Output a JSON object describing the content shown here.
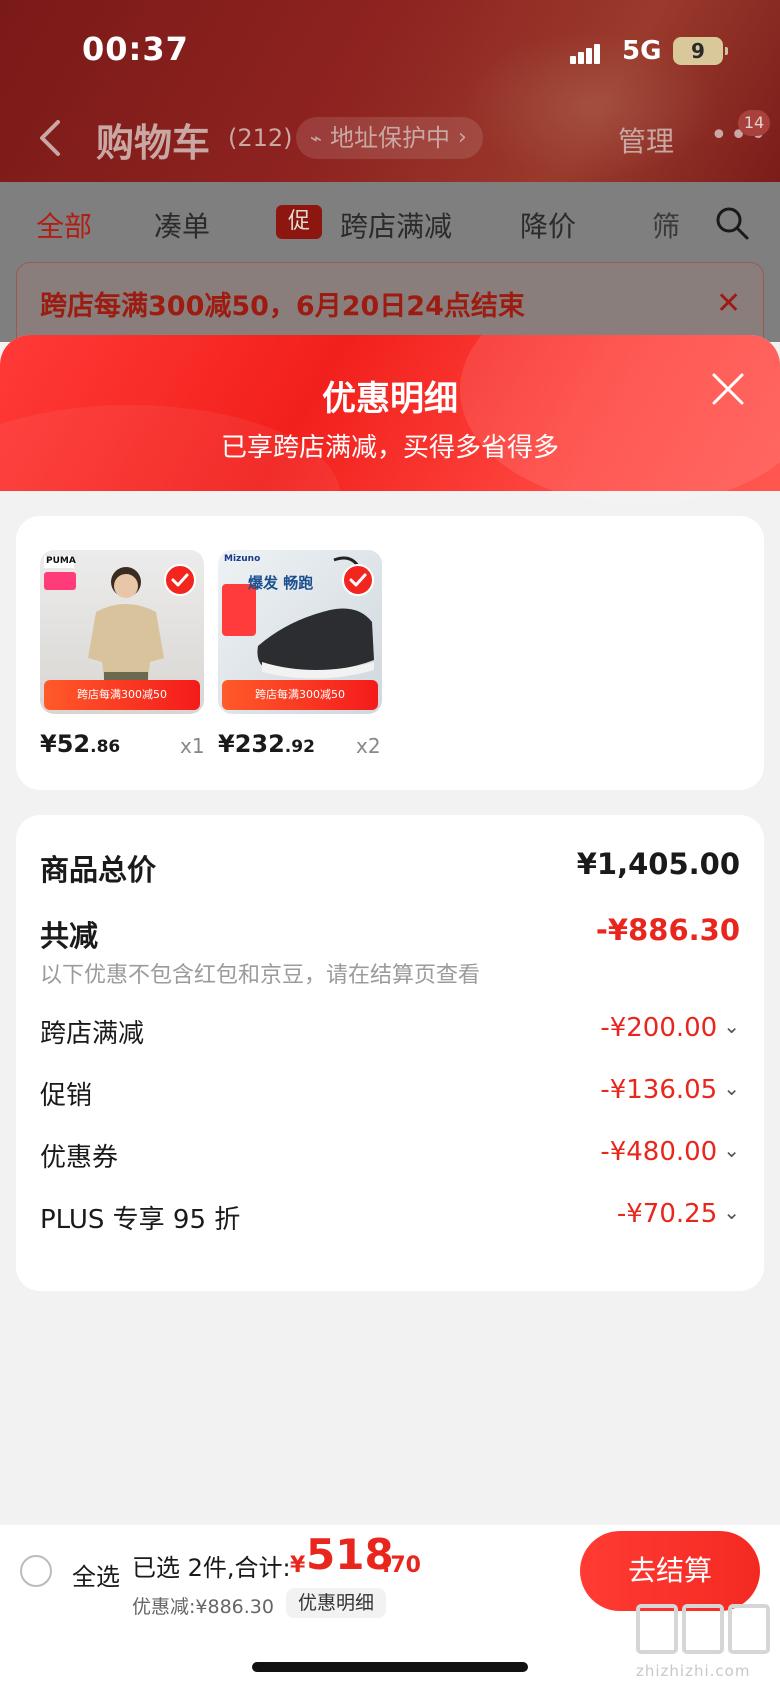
{
  "status_bar": {
    "time": "00:37",
    "network": "5G",
    "battery": "9"
  },
  "nav": {
    "title": "购物车",
    "count": "(212)",
    "address_protect": "地址保护中",
    "manage": "管理",
    "more_badge": "14"
  },
  "tabs": [
    {
      "label": "全部",
      "active": true
    },
    {
      "label": "凑单"
    },
    {
      "label": "跨店满减",
      "tag": "促"
    },
    {
      "label": "降价"
    },
    {
      "label": "筛"
    }
  ],
  "promo_banner": {
    "text": "跨店每满300减50，6月20日24点结束"
  },
  "sheet": {
    "title": "优惠明细",
    "subtitle": "已享跨店满减，买得多省得多"
  },
  "products": [
    {
      "brand": "PUMA",
      "price_int": "¥52",
      "price_dec": ".86",
      "qty": "x1",
      "tag": "跨店每满300减50"
    },
    {
      "brand": "Mizuno",
      "price_int": "¥232",
      "price_dec": ".92",
      "qty": "x2",
      "tag": "跨店每满300减50",
      "headline": "爆发 畅跑"
    }
  ],
  "summary": {
    "total_label": "商品总价",
    "total_value": "¥1,405.00",
    "reduce_label": "共减",
    "reduce_value": "-¥886.30",
    "note": "以下优惠不包含红包和京豆，请在结算页查看",
    "items": [
      {
        "label": "跨店满减",
        "value": "-¥200.00"
      },
      {
        "label": "促销",
        "value": "-¥136.05"
      },
      {
        "label": "优惠券",
        "value": "-¥480.00"
      },
      {
        "label": "PLUS 专享 95 折",
        "value": "-¥70.25"
      }
    ]
  },
  "bottom_bar": {
    "select_all": "全选",
    "selected_info": "已选 2件,合计:",
    "total_yen": "¥",
    "total_int": "518",
    "total_dec": ".70",
    "discount_line": "优惠减:¥886.30",
    "detail_button": "优惠明细",
    "checkout_button": "去结算"
  },
  "colors": {
    "accent_red": "#e8261e",
    "sheet_header_red": "#f2201c",
    "page_background": "#f2f2f2"
  },
  "watermark": {
    "text": "zhizhizhi.com"
  }
}
